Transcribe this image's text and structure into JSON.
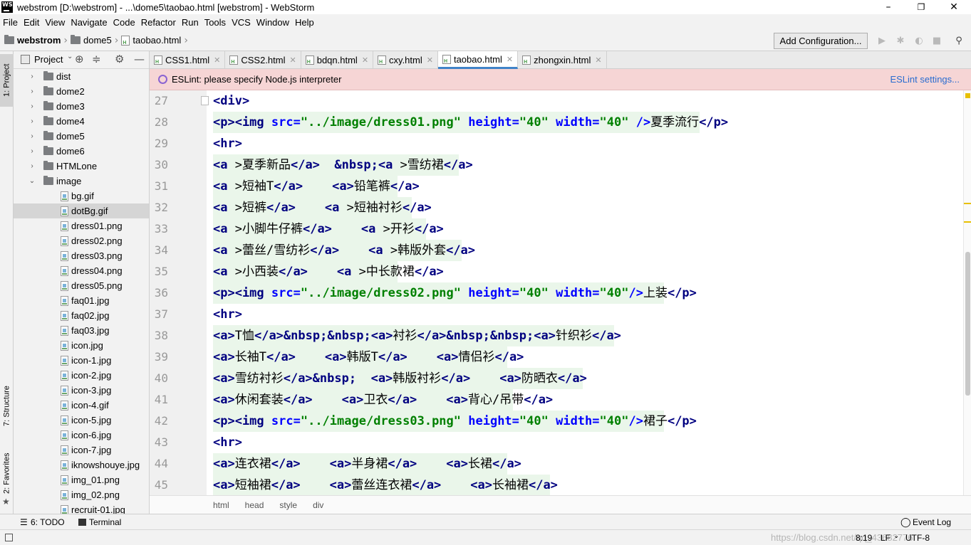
{
  "window": {
    "app_icon": "WS",
    "title": "webstrom [D:\\webstrom] - ...\\dome5\\taobao.html [webstrom] - WebStorm",
    "minimize": "–",
    "maximize": "❐",
    "close": "✕"
  },
  "menu": [
    "File",
    "Edit",
    "View",
    "Navigate",
    "Code",
    "Refactor",
    "Run",
    "Tools",
    "VCS",
    "Window",
    "Help"
  ],
  "nav": {
    "crumbs": [
      "webstrom",
      "dome5",
      "taobao.html"
    ],
    "add_config": "Add Configuration..."
  },
  "left_strip": {
    "project": "1: Project",
    "structure": "7: Structure",
    "favorites": "2: Favorites"
  },
  "project": {
    "header": "Project",
    "tree": [
      {
        "label": "dist",
        "type": "folder",
        "level": 1,
        "arrow": "›"
      },
      {
        "label": "dome2",
        "type": "folder",
        "level": 1,
        "arrow": "›"
      },
      {
        "label": "dome3",
        "type": "folder",
        "level": 1,
        "arrow": "›"
      },
      {
        "label": "dome4",
        "type": "folder",
        "level": 1,
        "arrow": "›"
      },
      {
        "label": "dome5",
        "type": "folder",
        "level": 1,
        "arrow": "›"
      },
      {
        "label": "dome6",
        "type": "folder",
        "level": 1,
        "arrow": "›"
      },
      {
        "label": "HTMLone",
        "type": "folder",
        "level": 1,
        "arrow": "›"
      },
      {
        "label": "image",
        "type": "folder",
        "level": 1,
        "arrow": "⌄"
      },
      {
        "label": "bg.gif",
        "type": "file",
        "level": 2
      },
      {
        "label": "dotBg.gif",
        "type": "file",
        "level": 2,
        "selected": true
      },
      {
        "label": "dress01.png",
        "type": "file",
        "level": 2
      },
      {
        "label": "dress02.png",
        "type": "file",
        "level": 2
      },
      {
        "label": "dress03.png",
        "type": "file",
        "level": 2
      },
      {
        "label": "dress04.png",
        "type": "file",
        "level": 2
      },
      {
        "label": "dress05.png",
        "type": "file",
        "level": 2
      },
      {
        "label": "faq01.jpg",
        "type": "file",
        "level": 2
      },
      {
        "label": "faq02.jpg",
        "type": "file",
        "level": 2
      },
      {
        "label": "faq03.jpg",
        "type": "file",
        "level": 2
      },
      {
        "label": "icon.jpg",
        "type": "file",
        "level": 2
      },
      {
        "label": "icon-1.jpg",
        "type": "file",
        "level": 2
      },
      {
        "label": "icon-2.jpg",
        "type": "file",
        "level": 2
      },
      {
        "label": "icon-3.jpg",
        "type": "file",
        "level": 2
      },
      {
        "label": "icon-4.gif",
        "type": "file",
        "level": 2
      },
      {
        "label": "icon-5.jpg",
        "type": "file",
        "level": 2
      },
      {
        "label": "icon-6.jpg",
        "type": "file",
        "level": 2
      },
      {
        "label": "icon-7.jpg",
        "type": "file",
        "level": 2
      },
      {
        "label": "iknowshouye.jpg",
        "type": "file",
        "level": 2
      },
      {
        "label": "img_01.png",
        "type": "file",
        "level": 2
      },
      {
        "label": "img_02.png",
        "type": "file",
        "level": 2
      },
      {
        "label": "recruit-01.jpg",
        "type": "file",
        "level": 2
      }
    ]
  },
  "tabs": [
    {
      "label": "CSS1.html",
      "active": false
    },
    {
      "label": "CSS2.html",
      "active": false
    },
    {
      "label": "bdqn.html",
      "active": false
    },
    {
      "label": "cxy.html",
      "active": false
    },
    {
      "label": "taobao.html",
      "active": true
    },
    {
      "label": "zhongxin.html",
      "active": false
    }
  ],
  "eslint": {
    "message": "ESLint: please specify Node.js interpreter",
    "settings": "ESLint settings..."
  },
  "editor": {
    "lines": [
      {
        "num": "27",
        "tokens": [
          [
            "t",
            "<div>"
          ]
        ]
      },
      {
        "num": "28",
        "tokens": [
          [
            "t",
            "<p><img "
          ],
          [
            "a",
            "src="
          ],
          [
            "s",
            "\"../image/dress01.png\""
          ],
          [
            "a",
            " height="
          ],
          [
            "s",
            "\"40\""
          ],
          [
            "a",
            " width="
          ],
          [
            "s",
            "\"40\""
          ],
          [
            "p",
            " />"
          ],
          [
            "x",
            "夏季流行"
          ],
          [
            "t",
            "</p>"
          ]
        ]
      },
      {
        "num": "29",
        "tokens": [
          [
            "t",
            "<hr>"
          ]
        ]
      },
      {
        "num": "30",
        "tokens": [
          [
            "t",
            "<a "
          ],
          [
            "x",
            ">夏季新品"
          ],
          [
            "t",
            "</a>"
          ],
          [
            "x",
            "  "
          ],
          [
            "b",
            "&nbsp;"
          ],
          [
            "t",
            "<a "
          ],
          [
            "x",
            ">雪纺裙"
          ],
          [
            "t",
            "</a>"
          ]
        ]
      },
      {
        "num": "31",
        "tokens": [
          [
            "t",
            "<a "
          ],
          [
            "x",
            ">短袖T"
          ],
          [
            "t",
            "</a>"
          ],
          [
            "x",
            "    "
          ],
          [
            "t",
            "<a>"
          ],
          [
            "x",
            "铅笔裤"
          ],
          [
            "t",
            "</a>"
          ]
        ]
      },
      {
        "num": "32",
        "tokens": [
          [
            "t",
            "<a "
          ],
          [
            "x",
            ">短裤"
          ],
          [
            "t",
            "</a>"
          ],
          [
            "x",
            "    "
          ],
          [
            "t",
            "<a "
          ],
          [
            "x",
            ">短袖衬衫"
          ],
          [
            "t",
            "</a>"
          ]
        ]
      },
      {
        "num": "33",
        "tokens": [
          [
            "t",
            "<a "
          ],
          [
            "x",
            ">小脚牛仔裤"
          ],
          [
            "t",
            "</a>"
          ],
          [
            "x",
            "    "
          ],
          [
            "t",
            "<a "
          ],
          [
            "x",
            ">开衫"
          ],
          [
            "t",
            "</a>"
          ]
        ]
      },
      {
        "num": "34",
        "tokens": [
          [
            "t",
            "<a "
          ],
          [
            "x",
            ">蕾丝/雪纺衫"
          ],
          [
            "t",
            "</a>"
          ],
          [
            "x",
            "    "
          ],
          [
            "t",
            "<a "
          ],
          [
            "x",
            ">韩版外套"
          ],
          [
            "t",
            "</a>"
          ]
        ]
      },
      {
        "num": "35",
        "tokens": [
          [
            "t",
            "<a "
          ],
          [
            "x",
            ">小西装"
          ],
          [
            "t",
            "</a>"
          ],
          [
            "x",
            "    "
          ],
          [
            "t",
            "<a "
          ],
          [
            "x",
            ">中长款裙"
          ],
          [
            "t",
            "</a>"
          ]
        ]
      },
      {
        "num": "36",
        "tokens": [
          [
            "t",
            "<p><img "
          ],
          [
            "a",
            "src="
          ],
          [
            "s",
            "\"../image/dress02.png\""
          ],
          [
            "a",
            " height="
          ],
          [
            "s",
            "\"40\""
          ],
          [
            "a",
            " width="
          ],
          [
            "s",
            "\"40\""
          ],
          [
            "p",
            "/>"
          ],
          [
            "x",
            "上装"
          ],
          [
            "t",
            "</p>"
          ]
        ]
      },
      {
        "num": "37",
        "tokens": [
          [
            "t",
            "<hr>"
          ]
        ]
      },
      {
        "num": "38",
        "tokens": [
          [
            "t",
            "<a>"
          ],
          [
            "x",
            "T恤"
          ],
          [
            "t",
            "</a>"
          ],
          [
            "b",
            "&nbsp;&nbsp;"
          ],
          [
            "t",
            "<a>"
          ],
          [
            "x",
            "衬衫"
          ],
          [
            "t",
            "</a>"
          ],
          [
            "b",
            "&nbsp;&nbsp;"
          ],
          [
            "t",
            "<a>"
          ],
          [
            "x",
            "针织衫"
          ],
          [
            "t",
            "</a>"
          ]
        ]
      },
      {
        "num": "39",
        "tokens": [
          [
            "t",
            "<a>"
          ],
          [
            "x",
            "长袖T"
          ],
          [
            "t",
            "</a>"
          ],
          [
            "x",
            "    "
          ],
          [
            "t",
            "<a>"
          ],
          [
            "x",
            "韩版T"
          ],
          [
            "t",
            "</a>"
          ],
          [
            "x",
            "    "
          ],
          [
            "t",
            "<a>"
          ],
          [
            "x",
            "情侣衫"
          ],
          [
            "t",
            "</a>"
          ]
        ]
      },
      {
        "num": "40",
        "tokens": [
          [
            "t",
            "<a>"
          ],
          [
            "x",
            "雪纺衬衫"
          ],
          [
            "t",
            "</a>"
          ],
          [
            "b",
            "&nbsp;"
          ],
          [
            "x",
            "  "
          ],
          [
            "t",
            "<a>"
          ],
          [
            "x",
            "韩版衬衫"
          ],
          [
            "t",
            "</a>"
          ],
          [
            "x",
            "    "
          ],
          [
            "t",
            "<a>"
          ],
          [
            "x",
            "防晒衣"
          ],
          [
            "t",
            "</a>"
          ]
        ]
      },
      {
        "num": "41",
        "tokens": [
          [
            "t",
            "<a>"
          ],
          [
            "x",
            "休闲套装"
          ],
          [
            "t",
            "</a>"
          ],
          [
            "x",
            "    "
          ],
          [
            "t",
            "<a>"
          ],
          [
            "x",
            "卫衣"
          ],
          [
            "t",
            "</a>"
          ],
          [
            "x",
            "    "
          ],
          [
            "t",
            "<a>"
          ],
          [
            "x",
            "背心/吊带"
          ],
          [
            "t",
            "</a>"
          ]
        ]
      },
      {
        "num": "42",
        "tokens": [
          [
            "t",
            "<p><img "
          ],
          [
            "a",
            "src="
          ],
          [
            "s",
            "\"../image/dress03.png\""
          ],
          [
            "a",
            " height="
          ],
          [
            "s",
            "\"40\""
          ],
          [
            "a",
            " width="
          ],
          [
            "s",
            "\"40\""
          ],
          [
            "p",
            "/>"
          ],
          [
            "x",
            "裙子"
          ],
          [
            "t",
            "</p>"
          ]
        ]
      },
      {
        "num": "43",
        "tokens": [
          [
            "t",
            "<hr>"
          ]
        ]
      },
      {
        "num": "44",
        "tokens": [
          [
            "t",
            "<a>"
          ],
          [
            "x",
            "连衣裙"
          ],
          [
            "t",
            "</a>"
          ],
          [
            "x",
            "    "
          ],
          [
            "t",
            "<a>"
          ],
          [
            "x",
            "半身裙"
          ],
          [
            "t",
            "</a>"
          ],
          [
            "x",
            "    "
          ],
          [
            "t",
            "<a>"
          ],
          [
            "x",
            "长裙"
          ],
          [
            "t",
            "</a>"
          ]
        ]
      },
      {
        "num": "45",
        "tokens": [
          [
            "t",
            "<a>"
          ],
          [
            "x",
            "短袖裙"
          ],
          [
            "t",
            "</a>"
          ],
          [
            "x",
            "    "
          ],
          [
            "t",
            "<a>"
          ],
          [
            "x",
            "蕾丝连衣裙"
          ],
          [
            "t",
            "</a>"
          ],
          [
            "x",
            "    "
          ],
          [
            "t",
            "<a>"
          ],
          [
            "x",
            "长袖裙"
          ],
          [
            "t",
            "</a>"
          ]
        ]
      }
    ]
  },
  "crumb_bar": [
    "html",
    "head",
    "style",
    "div"
  ],
  "bottom_tools": {
    "todo": "6: TODO",
    "terminal": "Terminal",
    "event_log": "Event Log"
  },
  "status": {
    "position": "8:19",
    "line_sep": "LF",
    "encoding": "UTF-8",
    "watermark": "https://blog.csdn.net/qq_43682776"
  }
}
